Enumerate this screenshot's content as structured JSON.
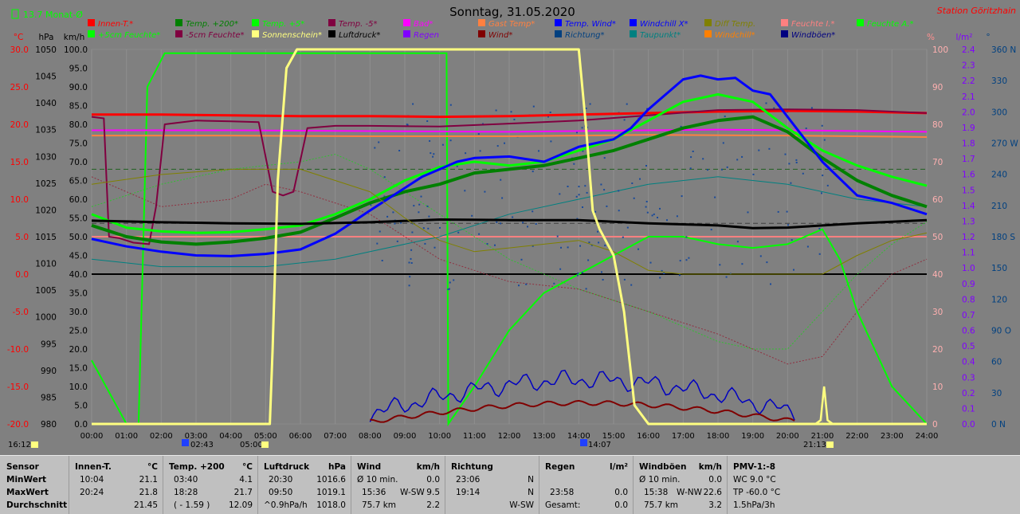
{
  "header": {
    "monthly_avg": "13.7 Monat-Ø",
    "title": "Sonntag, 31.05.2020",
    "station": "Station Göritzhain"
  },
  "colors": {
    "background": "#808080",
    "accent_red": "#ff0000"
  },
  "chart_data": {
    "type": "line",
    "title": "Sonntag, 31.05.2020",
    "x_ticks": [
      "00:00",
      "01:00",
      "02:00",
      "03:00",
      "04:00",
      "05:00",
      "06:00",
      "07:00",
      "08:00",
      "09:00",
      "10:00",
      "11:00",
      "12:00",
      "13:00",
      "14:00",
      "15:00",
      "16:00",
      "17:00",
      "18:00",
      "19:00",
      "20:00",
      "21:00",
      "22:00",
      "23:00",
      "24:00"
    ],
    "axes": {
      "temp_c": {
        "label": "°C",
        "ticks": [
          "30.0",
          "25.0",
          "20.0",
          "15.0",
          "10.0",
          "5.0",
          "0.0",
          "-5.0",
          "-10.0",
          "-15.0",
          "-20.0"
        ],
        "range": [
          -20,
          30
        ]
      },
      "pressure_hpa": {
        "label": "hPa",
        "ticks": [
          "1050",
          "1045",
          "1040",
          "1035",
          "1030",
          "1025",
          "1020",
          "1015",
          "1010",
          "1005",
          "1000",
          "995",
          "990",
          "985",
          "980"
        ],
        "range": [
          980,
          1050
        ]
      },
      "wind_kmh": {
        "label": "km/h",
        "ticks": [
          "100.0",
          "95.0",
          "90.0",
          "85.0",
          "80.0",
          "75.0",
          "70.0",
          "65.0",
          "60.0",
          "55.0",
          "50.0",
          "45.0",
          "40.0",
          "35.0",
          "30.0",
          "25.0",
          "20.0",
          "15.0",
          "10.0",
          "5.0",
          "0.0"
        ],
        "range": [
          0,
          100
        ]
      },
      "humidity_pct": {
        "label": "%",
        "ticks": [
          "100",
          "90",
          "80",
          "70",
          "60",
          "50",
          "40",
          "30",
          "20",
          "10",
          "0"
        ],
        "range": [
          0,
          100
        ]
      },
      "rain_lm2": {
        "label": "l/m²",
        "ticks": [
          "2.4",
          "2.3",
          "2.2",
          "2.1",
          "2.0",
          "1.9",
          "1.8",
          "1.7",
          "1.6",
          "1.5",
          "1.4",
          "1.3",
          "1.2",
          "1.1",
          "1.0",
          "0.9",
          "0.8",
          "0.7",
          "0.6",
          "0.5",
          "0.4",
          "0.3",
          "0.2",
          "0.1",
          "0.0"
        ],
        "range": [
          0,
          2.5
        ]
      },
      "direction_deg": {
        "label": "°",
        "ticks": [
          "360 N",
          "330",
          "300",
          "270 W",
          "240",
          "210",
          "180 S",
          "150",
          "120",
          "90 O",
          "60",
          "30",
          "0 N"
        ],
        "range": [
          0,
          360
        ]
      }
    },
    "legend": [
      {
        "name": "Innen-T.*",
        "color": "#ff0000"
      },
      {
        "name": "Temp. +200*",
        "color": "#008000"
      },
      {
        "name": "Temp. +5*",
        "color": "#00ff00"
      },
      {
        "name": "Temp. -5*",
        "color": "#800040"
      },
      {
        "name": "Bad*",
        "color": "#ff00ff"
      },
      {
        "name": "Gast Temp*",
        "color": "#ff8040"
      },
      {
        "name": "Temp. Wind*",
        "color": "#0000ff"
      },
      {
        "name": "Windchill X*",
        "color": "#0000ff"
      },
      {
        "name": "Diff Temp.",
        "color": "#808000"
      },
      {
        "name": "Feuchte I.*",
        "color": "#ff8080"
      },
      {
        "name": "Feuchte A.*",
        "color": "#00ff00"
      },
      {
        "name": "+5cm Feuchte*",
        "color": "#00ff00"
      },
      {
        "name": "-5cm Feuchte*",
        "color": "#800040"
      },
      {
        "name": "Sonnenschein*",
        "color": "#ffff80"
      },
      {
        "name": "Luftdruck*",
        "color": "#000000"
      },
      {
        "name": "Regen",
        "color": "#8000ff"
      },
      {
        "name": "Wind*",
        "color": "#800000"
      },
      {
        "name": "Richtung*",
        "color": "#004080"
      },
      {
        "name": "Taupunkt*",
        "color": "#008080"
      },
      {
        "name": "Windchill*",
        "color": "#ff8000"
      },
      {
        "name": "Windböen*",
        "color": "#000080"
      }
    ],
    "series": [
      {
        "name": "Innen-T.*",
        "color": "#ff0000",
        "width": 3,
        "axis": "temp_c",
        "x": [
          0,
          2,
          4,
          6,
          8,
          10,
          12,
          14,
          16,
          18,
          20,
          22,
          24
        ],
        "y": [
          21.3,
          21.3,
          21.2,
          21.1,
          21.1,
          21.0,
          21.1,
          21.3,
          21.5,
          21.7,
          21.8,
          21.7,
          21.5
        ]
      },
      {
        "name": "Bad*",
        "color": "#ff00ff",
        "width": 2,
        "axis": "temp_c",
        "x": [
          0,
          4,
          8,
          12,
          16,
          18,
          20,
          24
        ],
        "y": [
          19.2,
          19.2,
          19.1,
          19.0,
          19.2,
          19.3,
          19.2,
          19.0
        ]
      },
      {
        "name": "Gast Temp*",
        "color": "#ff8040",
        "width": 2,
        "axis": "temp_c",
        "x": [
          0,
          4,
          8,
          12,
          16,
          20,
          24
        ],
        "y": [
          18.5,
          18.5,
          18.4,
          18.4,
          18.6,
          18.5,
          18.3
        ]
      },
      {
        "name": "Temp. -5*",
        "color": "#800040",
        "width": 2,
        "axis": "temp_c",
        "x": [
          0,
          0.35,
          0.5,
          0.8,
          1.2,
          1.65,
          1.85,
          2.1,
          3,
          4,
          4.8,
          5.2,
          5.5,
          5.8,
          6.2,
          7,
          8,
          10,
          12,
          14,
          16,
          18,
          20,
          22,
          24
        ],
        "y": [
          21.0,
          20.8,
          5.0,
          4.8,
          4.2,
          4.0,
          9.0,
          20.0,
          20.5,
          20.4,
          20.3,
          11.0,
          10.5,
          11.0,
          19.5,
          19.8,
          19.8,
          19.7,
          20.1,
          20.5,
          21.2,
          21.9,
          22.0,
          21.9,
          21.5
        ]
      },
      {
        "name": "Temp. +200*",
        "color": "#008000",
        "width": 4,
        "axis": "temp_c",
        "x": [
          0,
          1,
          2,
          3,
          4,
          5,
          6,
          7,
          8,
          9,
          10,
          11,
          12,
          13,
          14,
          15,
          16,
          17,
          18,
          19,
          20,
          21,
          22,
          23,
          24
        ],
        "y": [
          6.5,
          5.0,
          4.3,
          4.0,
          4.3,
          4.8,
          5.6,
          7.5,
          9.5,
          11.0,
          12.0,
          13.5,
          14.0,
          14.5,
          15.5,
          16.5,
          18.0,
          19.5,
          20.5,
          21.0,
          19.0,
          15.5,
          12.5,
          10.5,
          9.0
        ]
      },
      {
        "name": "Temp. +5*",
        "color": "#00ff00",
        "width": 3,
        "axis": "temp_c",
        "x": [
          0,
          1,
          2,
          3,
          4,
          5,
          6,
          7,
          8,
          9,
          10,
          11,
          12,
          13,
          14,
          15,
          16,
          17,
          18,
          19,
          20,
          21,
          22,
          23,
          24
        ],
        "y": [
          8.0,
          6.2,
          5.7,
          5.5,
          5.6,
          6.0,
          6.5,
          8.0,
          10.0,
          12.5,
          14.3,
          15.0,
          14.5,
          15.0,
          16.5,
          18.0,
          20.5,
          23.0,
          24.0,
          23.0,
          19.5,
          16.5,
          14.5,
          13.0,
          11.8
        ]
      },
      {
        "name": "Temp. Wind*",
        "color": "#0000ff",
        "width": 3,
        "axis": "temp_c",
        "x": [
          0,
          1,
          2,
          3,
          4,
          5,
          6,
          7,
          8,
          9,
          9.5,
          10,
          10.5,
          11,
          12,
          13,
          14,
          15,
          15.5,
          16,
          17,
          17.5,
          18,
          18.5,
          19,
          19.5,
          20,
          21,
          22,
          23,
          24
        ],
        "y": [
          4.7,
          3.7,
          3.0,
          2.5,
          2.4,
          2.7,
          3.3,
          5.4,
          8.5,
          11.5,
          13.0,
          14.0,
          15.0,
          15.5,
          15.7,
          15.0,
          17.0,
          18.0,
          19.5,
          22.0,
          26.0,
          26.5,
          26.0,
          26.2,
          24.5,
          24.0,
          21.0,
          15.0,
          10.5,
          9.5,
          8.0
        ]
      },
      {
        "name": "Luftdruck*",
        "color": "#000000",
        "width": 3,
        "axis": "pressure_hpa",
        "x": [
          0,
          2,
          4,
          6,
          8,
          10,
          12,
          14,
          16,
          18,
          19,
          20,
          22,
          24
        ],
        "y": [
          1018.0,
          1017.7,
          1017.5,
          1017.4,
          1017.7,
          1018.2,
          1018.1,
          1018.1,
          1017.5,
          1017.1,
          1016.6,
          1016.7,
          1017.5,
          1018.1
        ]
      },
      {
        "name": "Diff Temp.",
        "color": "#808000",
        "width": 1,
        "axis": "temp_c",
        "x": [
          0,
          2,
          4,
          6,
          7,
          8,
          9,
          10,
          11,
          12,
          13,
          14,
          15,
          16,
          17,
          18,
          19,
          20,
          21,
          22,
          23,
          24
        ],
        "y": [
          12.0,
          13.3,
          14.0,
          14.0,
          12.5,
          11.0,
          7.5,
          4.5,
          3.0,
          3.5,
          4.0,
          4.5,
          3.0,
          0.5,
          0.0,
          0.0,
          0.0,
          0.0,
          0.0,
          2.5,
          4.5,
          5.5
        ]
      },
      {
        "name": "Sonnenschein*",
        "color": "#ffff80",
        "width": 3,
        "axis": "wind_kmh",
        "x": [
          0,
          5.12,
          5.2,
          5.35,
          5.6,
          5.9,
          6.0,
          14.0,
          14.2,
          14.4,
          14.6,
          15.0,
          15.3,
          15.6,
          16.0,
          24.0
        ],
        "y": [
          0,
          0,
          20,
          65,
          95,
          100,
          100,
          100,
          80,
          57,
          52,
          45,
          30,
          5,
          0,
          0
        ]
      }
    ]
  },
  "time_markers": {
    "left_time": "16:12",
    "sunrise": "02:43",
    "sunrise_bot": "05:00",
    "noon": "14:07",
    "sunset": "21:13"
  },
  "stats": {
    "sensor": {
      "header": "Sensor",
      "min": "MinWert",
      "max": "MaxWert",
      "avg": "Durchschnitt"
    },
    "innen": {
      "header": "Innen-T.",
      "unit": "°C",
      "min_time": "10:04",
      "min_val": "21.1",
      "max_time": "20:24",
      "max_val": "21.8",
      "avg": "21.45"
    },
    "temp200": {
      "header": "Temp. +200",
      "unit": "°C",
      "min_time": "03:40",
      "min_val": "4.1",
      "max_time": "18:28",
      "max_val": "21.7",
      "avg_left": "( - 1.59 )",
      "avg": "12.09"
    },
    "druck": {
      "header": "Luftdruck",
      "unit": "hPa",
      "min_time": "20:30",
      "min_val": "1016.6",
      "max_time": "09:50",
      "max_val": "1019.1",
      "avg_left": "^0.9hPa/h",
      "avg": "1018.0"
    },
    "wind": {
      "header": "Wind",
      "unit": "km/h",
      "min_left": "Ø 10 min.",
      "min_val": "0.0",
      "max_time": "15:36",
      "max_dir": "W-SW",
      "max_val": "9.5",
      "avg_left": "75.7 km",
      "avg": "2.2"
    },
    "richtung": {
      "header": "Richtung",
      "min_time": "23:06",
      "min_val": "N",
      "max_time": "19:14",
      "max_val": "N",
      "avg": "W-SW"
    },
    "regen": {
      "header": "Regen",
      "unit": "l/m²",
      "max_time": "23:58",
      "max_val": "0.0",
      "avg_left": "Gesamt:",
      "avg": "0.0"
    },
    "boeen": {
      "header": "Windböen",
      "unit": "km/h",
      "min_left": "Ø 10 min.",
      "min_val": "0.0",
      "max_time": "15:38",
      "max_dir": "W-NW",
      "max_val": "22.6",
      "avg_left": "75.7 km",
      "avg": "3.2"
    },
    "pmv": {
      "header": "PMV-1:-8",
      "min_val": "WC 9.0 °C",
      "max_val": "TP -60.0 °C",
      "avg": "1.5hPa/3h"
    }
  }
}
